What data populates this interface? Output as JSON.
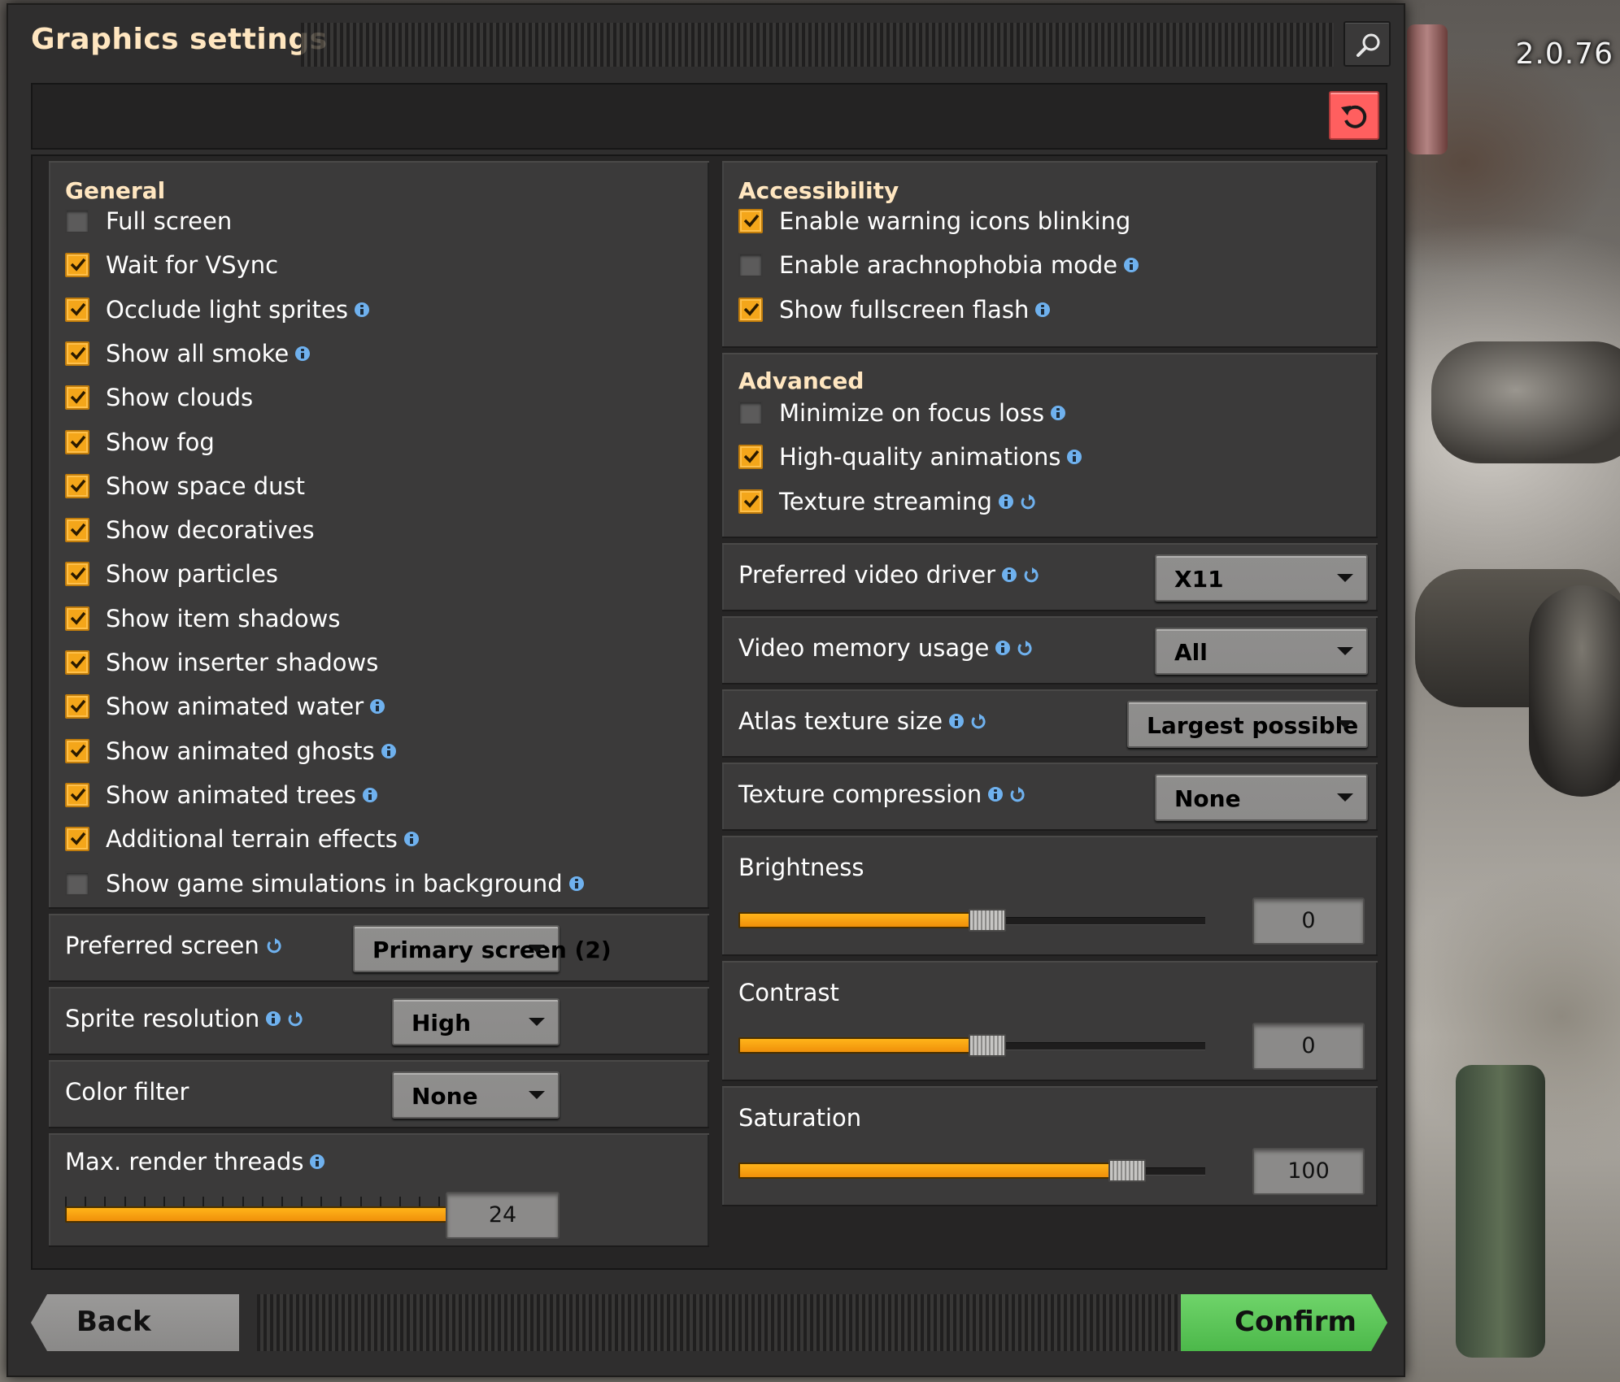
{
  "version": "2.0.76",
  "window": {
    "title": "Graphics settings"
  },
  "colors": {
    "accent_orange": "#f4a61a",
    "title_cream": "#ffe6c0",
    "reset_red": "#ff5f5f",
    "confirm_green": "#5cc65a",
    "info_blue": "#6fb1ee"
  },
  "general": {
    "title": "General",
    "checkboxes": [
      {
        "label": "Full screen",
        "checked": false,
        "info": false
      },
      {
        "label": "Wait for VSync",
        "checked": true,
        "info": false
      },
      {
        "label": "Occlude light sprites",
        "checked": true,
        "info": true
      },
      {
        "label": "Show all smoke",
        "checked": true,
        "info": true
      },
      {
        "label": "Show clouds",
        "checked": true,
        "info": false
      },
      {
        "label": "Show fog",
        "checked": true,
        "info": false
      },
      {
        "label": "Show space dust",
        "checked": true,
        "info": false
      },
      {
        "label": "Show decoratives",
        "checked": true,
        "info": false
      },
      {
        "label": "Show particles",
        "checked": true,
        "info": false
      },
      {
        "label": "Show item shadows",
        "checked": true,
        "info": false
      },
      {
        "label": "Show inserter shadows",
        "checked": true,
        "info": false
      },
      {
        "label": "Show animated water",
        "checked": true,
        "info": true
      },
      {
        "label": "Show animated ghosts",
        "checked": true,
        "info": true
      },
      {
        "label": "Show animated trees",
        "checked": true,
        "info": true
      },
      {
        "label": "Additional terrain effects",
        "checked": true,
        "info": true
      },
      {
        "label": "Show game simulations in background",
        "checked": false,
        "info": true
      }
    ]
  },
  "preferred_screen": {
    "label": "Preferred screen",
    "value": "Primary screen (2)"
  },
  "sprite_resolution": {
    "label": "Sprite resolution",
    "value": "High"
  },
  "color_filter": {
    "label": "Color filter",
    "value": "None"
  },
  "render_threads": {
    "label": "Max. render threads",
    "value": "24",
    "fraction": 1.0
  },
  "accessibility": {
    "title": "Accessibility",
    "checkboxes": [
      {
        "label": "Enable warning icons blinking",
        "checked": true
      },
      {
        "label": "Enable arachnophobia mode",
        "checked": false
      },
      {
        "label": "Show fullscreen flash",
        "checked": true
      }
    ]
  },
  "advanced": {
    "title": "Advanced",
    "checkboxes": [
      {
        "label": "Minimize on focus loss",
        "checked": false
      },
      {
        "label": "High-quality animations",
        "checked": true
      },
      {
        "label": "Texture streaming",
        "checked": true
      }
    ]
  },
  "video_driver": {
    "label": "Preferred video driver",
    "value": "X11"
  },
  "video_memory": {
    "label": "Video memory usage",
    "value": "All"
  },
  "atlas_size": {
    "label": "Atlas texture size",
    "value": "Largest possible"
  },
  "texture_compression": {
    "label": "Texture compression",
    "value": "None"
  },
  "brightness": {
    "label": "Brightness",
    "value": "0",
    "fraction": 0.5
  },
  "contrast": {
    "label": "Contrast",
    "value": "0",
    "fraction": 0.5
  },
  "saturation": {
    "label": "Saturation",
    "value": "100",
    "fraction": 0.8
  },
  "buttons": {
    "back": "Back",
    "confirm": "Confirm"
  },
  "icons": {
    "search": "magnifier-icon",
    "reset": "reset-arrow-icon",
    "info": "info-icon",
    "restart": "restart-required-icon"
  }
}
